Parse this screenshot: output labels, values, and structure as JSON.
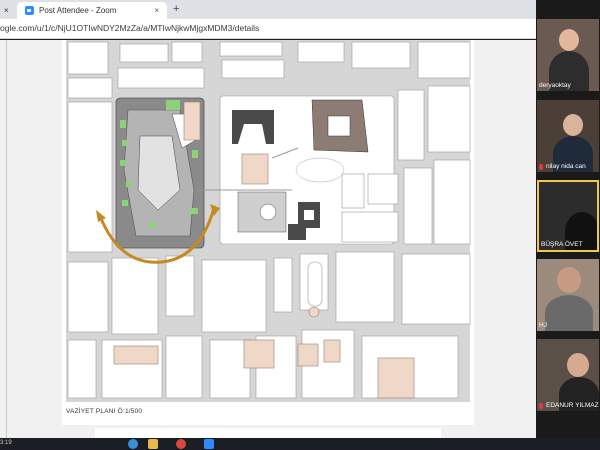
{
  "browser": {
    "tab_title": "Post Attendee - Zoom",
    "tab_close": "×",
    "new_tab": "+",
    "url": "ogle.com/u/1/c/NjU1OTIwNDY2MzZa/a/MTIwNjkwMjgxMDM3/details"
  },
  "document": {
    "caption": "VAZİYET PLANI  Ö:1/500"
  },
  "participants": [
    {
      "name": "deryaoktay",
      "muted": false
    },
    {
      "name": "nilay nida can",
      "muted": true
    },
    {
      "name": "BÜŞRA ÖVET",
      "muted": false,
      "active": true
    },
    {
      "name": "HJ",
      "muted": false
    },
    {
      "name": "EDANUR YILMAZ",
      "muted": true
    }
  ],
  "colors": {
    "plan_background": "#d6d6d6",
    "building_fill": "#ffffff",
    "accent_arrow": "#c8891e",
    "green_space": "#8fd07a",
    "historic_fill": "#f0d8c8",
    "active_speaker": "#f2c84b"
  },
  "taskbar": {
    "clock": "3:19"
  }
}
